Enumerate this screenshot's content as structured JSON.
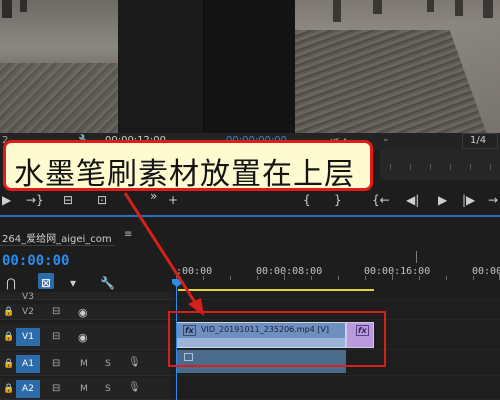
{
  "program_monitor_left": {
    "timecode": "00:00:12:00",
    "frame_fraction": "2"
  },
  "program_monitor_right": {
    "timecode": "00:00:00:00",
    "fit_label": "适合",
    "quality": "1/4"
  },
  "callout": {
    "text": "水墨笔刷素材放置在上层",
    "border_color": "#e01b18",
    "background_color": "#fffbd0"
  },
  "sequence": {
    "tab_title": "264_爱给网_aigei_com",
    "close_label": "≡",
    "current_timecode": "00:00:00"
  },
  "ruler": {
    "labels": [
      ":00:00",
      "00:00:08:00",
      "00:00:16:00",
      "00:00:2"
    ]
  },
  "tracks": {
    "video": [
      {
        "name": "V3",
        "active": false
      },
      {
        "name": "V2",
        "active": false
      },
      {
        "name": "V1",
        "active": true
      }
    ],
    "audio": [
      {
        "name": "A1",
        "mute": "M",
        "solo": "S"
      },
      {
        "name": "A2",
        "mute": "M",
        "solo": "S"
      }
    ]
  },
  "clips": {
    "v1_clip_name": "VID_20191011_235206.mp4 [V]",
    "fx_label": "fx"
  },
  "colors": {
    "accent_blue": "#2d8ceb",
    "work_area": "#e0d43b",
    "clip_video": "#9bb3d6",
    "clip_fx": "#b79bdc",
    "highlight_red": "#d6201c"
  }
}
